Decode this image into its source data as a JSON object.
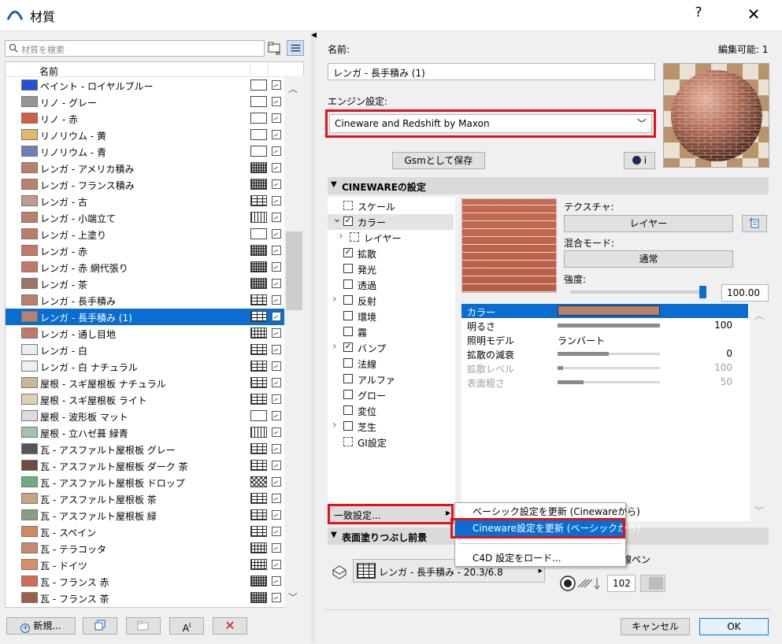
{
  "window": {
    "title": "材質",
    "help": "?",
    "close": "✕"
  },
  "left": {
    "search_placeholder": "材質を検索",
    "column_header": "名前",
    "materials": [
      {
        "name": "ペイント - ロイヤルブルー",
        "color": "#1f52d8",
        "pattern": "empty"
      },
      {
        "name": "リノ - グレー",
        "color": "#9a9590",
        "pattern": "empty"
      },
      {
        "name": "リノ - 赤",
        "color": "#d35b48",
        "pattern": "empty"
      },
      {
        "name": "リノリウム - 黄",
        "color": "#e0b96a",
        "pattern": "empty"
      },
      {
        "name": "リノリウム - 青",
        "color": "#6d7fb8",
        "pattern": "empty"
      },
      {
        "name": "レンガ - アメリカ積み",
        "color": "#b9806d",
        "pattern": "dense"
      },
      {
        "name": "レンガ - フランス積み",
        "color": "#b9806d",
        "pattern": "dense"
      },
      {
        "name": "レンガ - 古",
        "color": "#c09b8e",
        "pattern": "brick"
      },
      {
        "name": "レンガ - 小端立て",
        "color": "#b9806d",
        "pattern": "vert"
      },
      {
        "name": "レンガ - 上塗り",
        "color": "#c07a68",
        "pattern": "empty"
      },
      {
        "name": "レンガ - 赤",
        "color": "#c4786a",
        "pattern": "dense"
      },
      {
        "name": "レンガ - 赤 網代張り",
        "color": "#c4786a",
        "pattern": "dense"
      },
      {
        "name": "レンガ - 茶",
        "color": "#9c7563",
        "pattern": "dense"
      },
      {
        "name": "レンガ - 長手積み",
        "color": "#b9806d",
        "pattern": "brick"
      },
      {
        "name": "レンガ - 長手積み (1)",
        "color": "#b9806d",
        "pattern": "brick",
        "selected": true
      },
      {
        "name": "レンガ - 通し目地",
        "color": "#c4786a",
        "pattern": "grid"
      },
      {
        "name": "レンガ - 白",
        "color": "#ececec",
        "pattern": "brick"
      },
      {
        "name": "レンガ - 白 ナチュラル",
        "color": "#efefef",
        "pattern": "brick"
      },
      {
        "name": "屋根 - スギ屋根板 ナチュラル",
        "color": "#c9b79a",
        "pattern": "brick"
      },
      {
        "name": "屋根 - スギ屋根板 ライト",
        "color": "#e3cfb0",
        "pattern": "brick"
      },
      {
        "name": "屋根 - 波形板 マット",
        "color": "#dcdcdc",
        "pattern": "empty"
      },
      {
        "name": "屋根 - 立ハゼ葺 緑青",
        "color": "#9fc4a8",
        "pattern": "vert"
      },
      {
        "name": "瓦 - アスファルト屋根板 グレー",
        "color": "#555555",
        "pattern": "brick"
      },
      {
        "name": "瓦 - アスファルト屋根板 ダーク 茶",
        "color": "#6e4b3e",
        "pattern": "brick"
      },
      {
        "name": "瓦 - アスファルト屋根板 ドロップ",
        "color": "#6cae83",
        "pattern": "diamond"
      },
      {
        "name": "瓦 - アスファルト屋根板 茶",
        "color": "#c9a47e",
        "pattern": "brick"
      },
      {
        "name": "瓦 - アスファルト屋根板 緑",
        "color": "#8c9d80",
        "pattern": "brick"
      },
      {
        "name": "瓦 - スペイン",
        "color": "#d18a5c",
        "pattern": "brick"
      },
      {
        "name": "瓦 - テラコッタ",
        "color": "#c98a6a",
        "pattern": "grid"
      },
      {
        "name": "瓦 - ドイツ",
        "color": "#d98e62",
        "pattern": "grid"
      },
      {
        "name": "瓦 - フランス 赤",
        "color": "#d66a54",
        "pattern": "dense"
      },
      {
        "name": "瓦 - フランス 茶",
        "color": "#9c5f4a",
        "pattern": "dense"
      }
    ],
    "buttons": {
      "new": "新規...",
      "add": "",
      "folder": "",
      "rename": "A",
      "delete": "✕"
    }
  },
  "right": {
    "name_label": "名前:",
    "editable": "編集可能: 1",
    "name_value": "レンガ - 長手積み (1)",
    "engine_label": "エンジン設定:",
    "engine_value": "Cineware and Redshift by Maxon",
    "save_gsm": "Gsmとして保存",
    "info_btn": "i",
    "section_cineware": "CINEWAREの設定",
    "tree": [
      {
        "label": "スケール",
        "indent": 0,
        "check": "icon",
        "expander": ""
      },
      {
        "label": "カラー",
        "indent": 0,
        "check": "checked",
        "expander": "v",
        "selected": true
      },
      {
        "label": "レイヤー",
        "indent": 1,
        "check": "icon",
        "expander": ">"
      },
      {
        "label": "拡散",
        "indent": 0,
        "check": "checked",
        "expander": ""
      },
      {
        "label": "発光",
        "indent": 0,
        "check": "unchecked",
        "expander": ""
      },
      {
        "label": "透過",
        "indent": 0,
        "check": "unchecked",
        "expander": ""
      },
      {
        "label": "反射",
        "indent": 0,
        "check": "unchecked",
        "expander": ">"
      },
      {
        "label": "環境",
        "indent": 0,
        "check": "unchecked",
        "expander": ""
      },
      {
        "label": "霧",
        "indent": 0,
        "check": "unchecked",
        "expander": ""
      },
      {
        "label": "バンプ",
        "indent": 0,
        "check": "checked",
        "expander": ">"
      },
      {
        "label": "法線",
        "indent": 0,
        "check": "unchecked",
        "expander": ""
      },
      {
        "label": "アルファ",
        "indent": 0,
        "check": "unchecked",
        "expander": ""
      },
      {
        "label": "グロー",
        "indent": 0,
        "check": "unchecked",
        "expander": ""
      },
      {
        "label": "変位",
        "indent": 0,
        "check": "unchecked",
        "expander": ""
      },
      {
        "label": "芝生",
        "indent": 0,
        "check": "unchecked",
        "expander": ">"
      },
      {
        "label": "GI設定",
        "indent": 0,
        "check": "icon",
        "expander": ""
      }
    ],
    "texture_label": "テクスチャ:",
    "layer_btn": "レイヤー",
    "blend_label": "混合モード:",
    "blend_value": "通常",
    "intensity_label": "強度:",
    "intensity_value": "100.00",
    "properties": [
      {
        "name": "カラー",
        "value": "",
        "level": null,
        "dim": false,
        "selected": true,
        "swatch": "#b9806d"
      },
      {
        "name": "明るさ",
        "value": "100",
        "level": 1.0,
        "dim": false
      },
      {
        "name": "照明モデル",
        "value": "ランバート",
        "level": null,
        "dim": false,
        "text_value": true
      },
      {
        "name": "拡散の減衰",
        "value": "0",
        "level": 0.5,
        "dim": false
      },
      {
        "name": "拡散レベル",
        "value": "100",
        "level": 0.05,
        "dim": true
      },
      {
        "name": "表面粗さ",
        "value": "50",
        "level": 0.25,
        "dim": true
      }
    ],
    "match_btn": "一致設定...",
    "context_menu": [
      {
        "label": "ベーシック設定を更新 (Cinewareから)"
      },
      {
        "label": "Cineware設定を更新 (ベーシックから)",
        "highlighted": true
      },
      {
        "label": "C4D 設定をロード..."
      }
    ],
    "section_surface": "表面塗りつぶし前景",
    "surface_value": "レンガ - 長手積み - 20.3/6.8",
    "line_pen_label": "線ペン",
    "pen_number": "102",
    "cancel": "キャンセル",
    "ok": "OK"
  },
  "colors": {
    "accent": "#0a6ed1",
    "highlight_red": "#e0121b"
  }
}
